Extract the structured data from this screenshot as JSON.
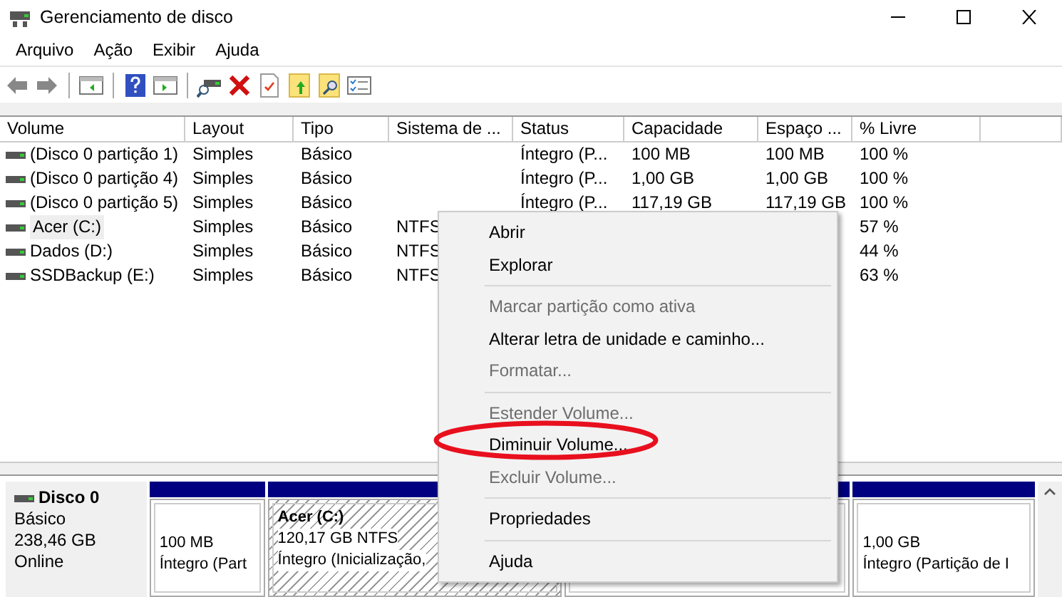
{
  "window": {
    "title": "Gerenciamento de disco"
  },
  "menu": [
    "Arquivo",
    "Ação",
    "Exibir",
    "Ajuda"
  ],
  "table": {
    "columns": [
      "Volume",
      "Layout",
      "Tipo",
      "Sistema de ...",
      "Status",
      "Capacidade",
      "Espaço ...",
      "% Livre"
    ],
    "rows": [
      {
        "volume": "(Disco 0 partição 1)",
        "layout": "Simples",
        "tipo": "Básico",
        "status": "Íntegro (P...",
        "capacidade": "100 MB",
        "espaco": "100 MB",
        "livre": "100 %",
        "selected": false
      },
      {
        "volume": "(Disco 0 partição 4)",
        "layout": "Simples",
        "tipo": "Básico",
        "status": "Íntegro (P...",
        "capacidade": "1,00 GB",
        "espaco": "1,00 GB",
        "livre": "100 %",
        "selected": false
      },
      {
        "volume": "(Disco 0 partição 5)",
        "layout": "Simples",
        "tipo": "Básico",
        "status": "Íntegro (P...",
        "capacidade": "117,19 GB",
        "espaco": "117,19 GB",
        "livre": "100 %",
        "selected": false
      },
      {
        "volume": "Acer (C:)",
        "layout": "Simples",
        "tipo": "Básico",
        "sistema": "NTFS",
        "livre": "57 %",
        "selected": true
      },
      {
        "volume": "Dados (D:)",
        "layout": "Simples",
        "tipo": "Básico",
        "sistema": "NTFS",
        "livre": "44 %",
        "selected": false
      },
      {
        "volume": "SSDBackup (E:)",
        "layout": "Simples",
        "tipo": "Básico",
        "sistema": "NTFS",
        "livre": "63 %",
        "selected": false
      }
    ]
  },
  "disk": {
    "name": "Disco 0",
    "type": "Básico",
    "size": "238,46 GB",
    "state": "Online",
    "partitions": [
      {
        "lines": [
          "100 MB",
          "Íntegro (Part"
        ],
        "selected": false
      },
      {
        "title": "Acer  (C:)",
        "lines": [
          "120,17 GB NTFS",
          "Íntegro (Inicialização,"
        ],
        "selected": true
      },
      {
        "selected": false
      },
      {
        "lines": [
          "1,00 GB",
          "Íntegro (Partição de I"
        ],
        "selected": false
      }
    ]
  },
  "context_menu": [
    {
      "kind": "item",
      "label": "Abrir",
      "disabled": false
    },
    {
      "kind": "item",
      "label": "Explorar",
      "disabled": false
    },
    {
      "kind": "separator"
    },
    {
      "kind": "item",
      "label": "Marcar partição como ativa",
      "disabled": true
    },
    {
      "kind": "item",
      "label": "Alterar letra de unidade e caminho...",
      "disabled": false
    },
    {
      "kind": "item",
      "label": "Formatar...",
      "disabled": true
    },
    {
      "kind": "separator"
    },
    {
      "kind": "item",
      "label": "Estender Volume...",
      "disabled": true
    },
    {
      "kind": "item",
      "label": "Diminuir Volume...",
      "disabled": false
    },
    {
      "kind": "item",
      "label": "Excluir Volume...",
      "disabled": true
    },
    {
      "kind": "separator"
    },
    {
      "kind": "item",
      "label": "Propriedades",
      "disabled": false
    },
    {
      "kind": "separator"
    },
    {
      "kind": "item",
      "label": "Ajuda",
      "disabled": false
    }
  ]
}
